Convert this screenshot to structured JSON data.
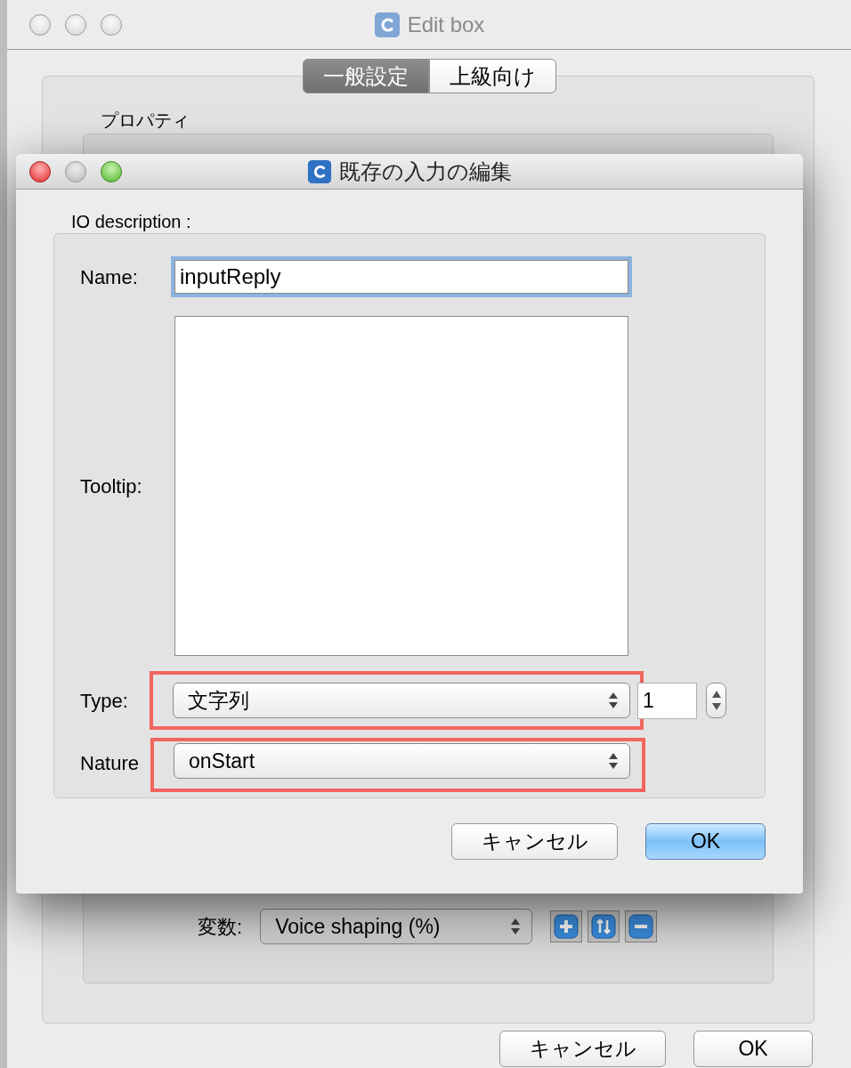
{
  "background_window": {
    "title": "Edit box",
    "active": false,
    "tabs": [
      {
        "label": "一般設定",
        "selected": true
      },
      {
        "label": "上級向け",
        "selected": false
      }
    ],
    "group_title": "プロパティ",
    "variable": {
      "label": "変数:",
      "value": "Voice shaping (%)"
    },
    "buttons": [
      {
        "label": "キャンセル"
      },
      {
        "label": "OK"
      }
    ]
  },
  "dialog": {
    "title": "既存の入力の編集",
    "active": true,
    "group_title": "IO description :",
    "name": {
      "label": "Name:",
      "value": "inputReply",
      "focused": true
    },
    "tooltip": {
      "label": "Tooltip:"
    },
    "type": {
      "label": "Type:",
      "value": "文字列",
      "highlighted": true,
      "count": "1"
    },
    "nature": {
      "label": "Nature",
      "value": "onStart",
      "highlighted": true
    },
    "buttons": [
      {
        "label": "キャンセル",
        "kind": "default"
      },
      {
        "label": "OK",
        "kind": "primary"
      }
    ]
  }
}
